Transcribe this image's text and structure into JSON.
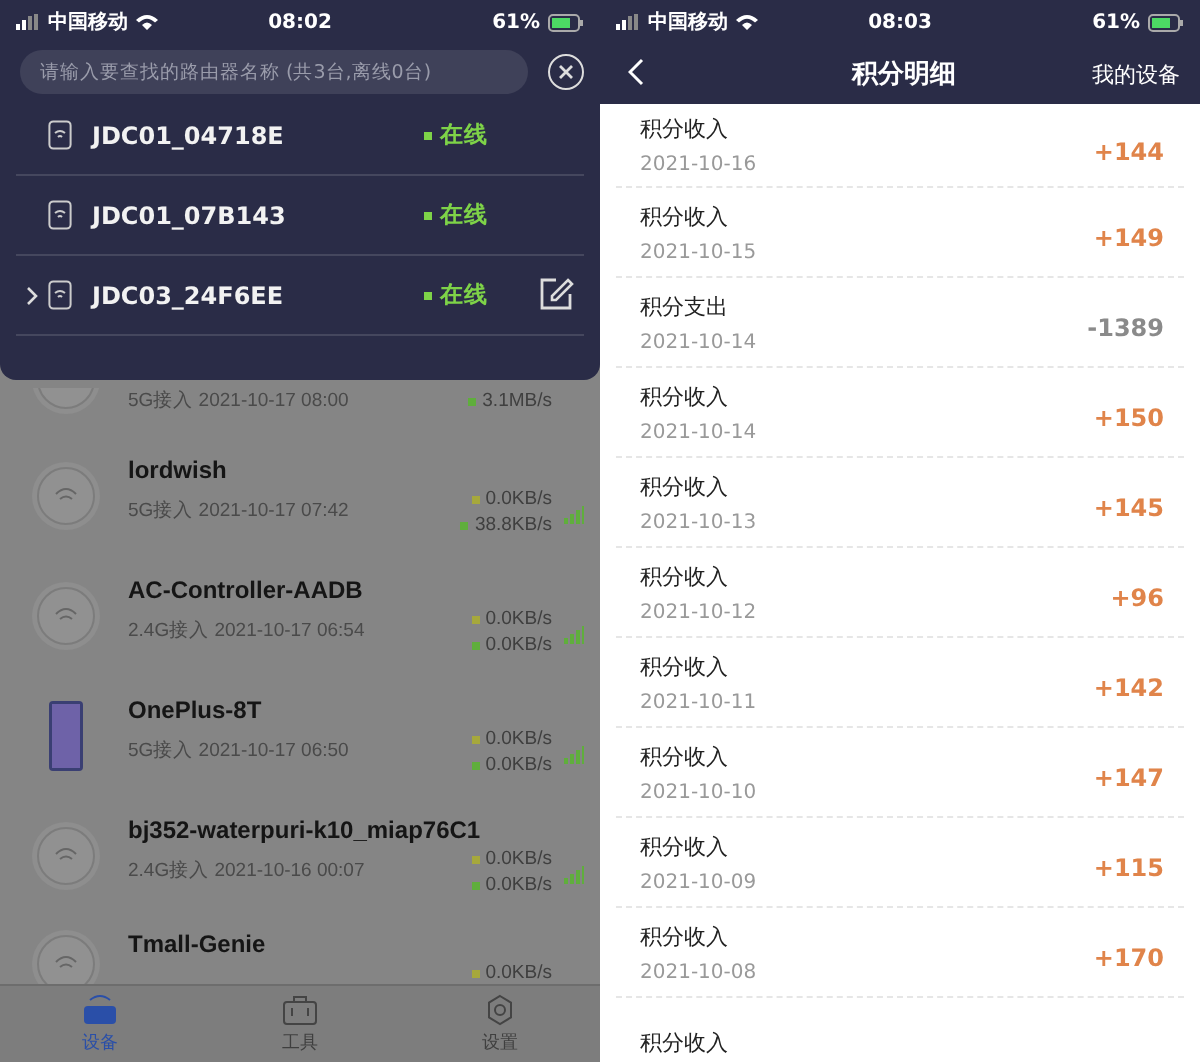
{
  "left_screen": {
    "status_bar": {
      "carrier": "中国移动",
      "time": "08:02",
      "battery": "61%"
    },
    "search": {
      "placeholder": "请输入要查找的路由器名称 (共3台,离线0台)"
    },
    "routers": [
      {
        "name": "JDC01_04718E",
        "status": "在线",
        "selected": false
      },
      {
        "name": "JDC01_07B143",
        "status": "在线",
        "selected": false
      },
      {
        "name": "JDC03_24F6EE",
        "status": "在线",
        "selected": true
      }
    ],
    "devices": [
      {
        "kind": "router",
        "subtitle": "5G接入 2021-10-17 08:00",
        "speeds": [
          {
            "text": "3.1MB/s",
            "color": "#5fae3c"
          }
        ]
      },
      {
        "kind": "router",
        "name": "lordwish",
        "subtitle": "5G接入 2021-10-17 07:42",
        "speeds": [
          {
            "text": "0.0KB/s",
            "color": "#a6a83c"
          },
          {
            "text": "38.8KB/s",
            "color": "#5fae3c"
          }
        ]
      },
      {
        "kind": "router",
        "name": "AC-Controller-AADB",
        "subtitle": "2.4G接入 2021-10-17 06:54",
        "speeds": [
          {
            "text": "0.0KB/s",
            "color": "#a6a83c"
          },
          {
            "text": "0.0KB/s",
            "color": "#5fae3c"
          }
        ]
      },
      {
        "kind": "phone",
        "name": "OnePlus-8T",
        "subtitle": "5G接入 2021-10-17 06:50",
        "speeds": [
          {
            "text": "0.0KB/s",
            "color": "#a6a83c"
          },
          {
            "text": "0.0KB/s",
            "color": "#5fae3c"
          }
        ]
      },
      {
        "kind": "router",
        "name": "bj352-waterpuri-k10_miap76C1",
        "subtitle": "2.4G接入 2021-10-16 00:07",
        "speeds": [
          {
            "text": "0.0KB/s",
            "color": "#a6a83c"
          },
          {
            "text": "0.0KB/s",
            "color": "#5fae3c"
          }
        ]
      },
      {
        "kind": "router",
        "name": "Tmall-Genie",
        "speeds": [
          {
            "text": "0.0KB/s",
            "color": "#a6a83c"
          }
        ]
      }
    ],
    "tabs": [
      {
        "kind": "devices",
        "label": "设备",
        "selected": true
      },
      {
        "kind": "tools",
        "label": "工具",
        "selected": false
      },
      {
        "kind": "settings",
        "label": "设置",
        "selected": false
      }
    ]
  },
  "right_screen": {
    "status_bar": {
      "carrier": "中国移动",
      "time": "08:03",
      "battery": "61%"
    },
    "title": "积分明细",
    "action": "我的设备",
    "entries": [
      {
        "label": "积分收入",
        "date": "2021-10-16",
        "amount": "+144",
        "kind": "income"
      },
      {
        "label": "积分收入",
        "date": "2021-10-15",
        "amount": "+149",
        "kind": "income"
      },
      {
        "label": "积分支出",
        "date": "2021-10-14",
        "amount": "-1389",
        "kind": "expense"
      },
      {
        "label": "积分收入",
        "date": "2021-10-14",
        "amount": "+150",
        "kind": "income"
      },
      {
        "label": "积分收入",
        "date": "2021-10-13",
        "amount": "+145",
        "kind": "income"
      },
      {
        "label": "积分收入",
        "date": "2021-10-12",
        "amount": "+96",
        "kind": "income"
      },
      {
        "label": "积分收入",
        "date": "2021-10-11",
        "amount": "+142",
        "kind": "income"
      },
      {
        "label": "积分收入",
        "date": "2021-10-10",
        "amount": "+147",
        "kind": "income"
      },
      {
        "label": "积分收入",
        "date": "2021-10-09",
        "amount": "+115",
        "kind": "income"
      },
      {
        "label": "积分收入",
        "date": "2021-10-08",
        "amount": "+170",
        "kind": "income"
      },
      {
        "label": "积分收入"
      }
    ]
  }
}
